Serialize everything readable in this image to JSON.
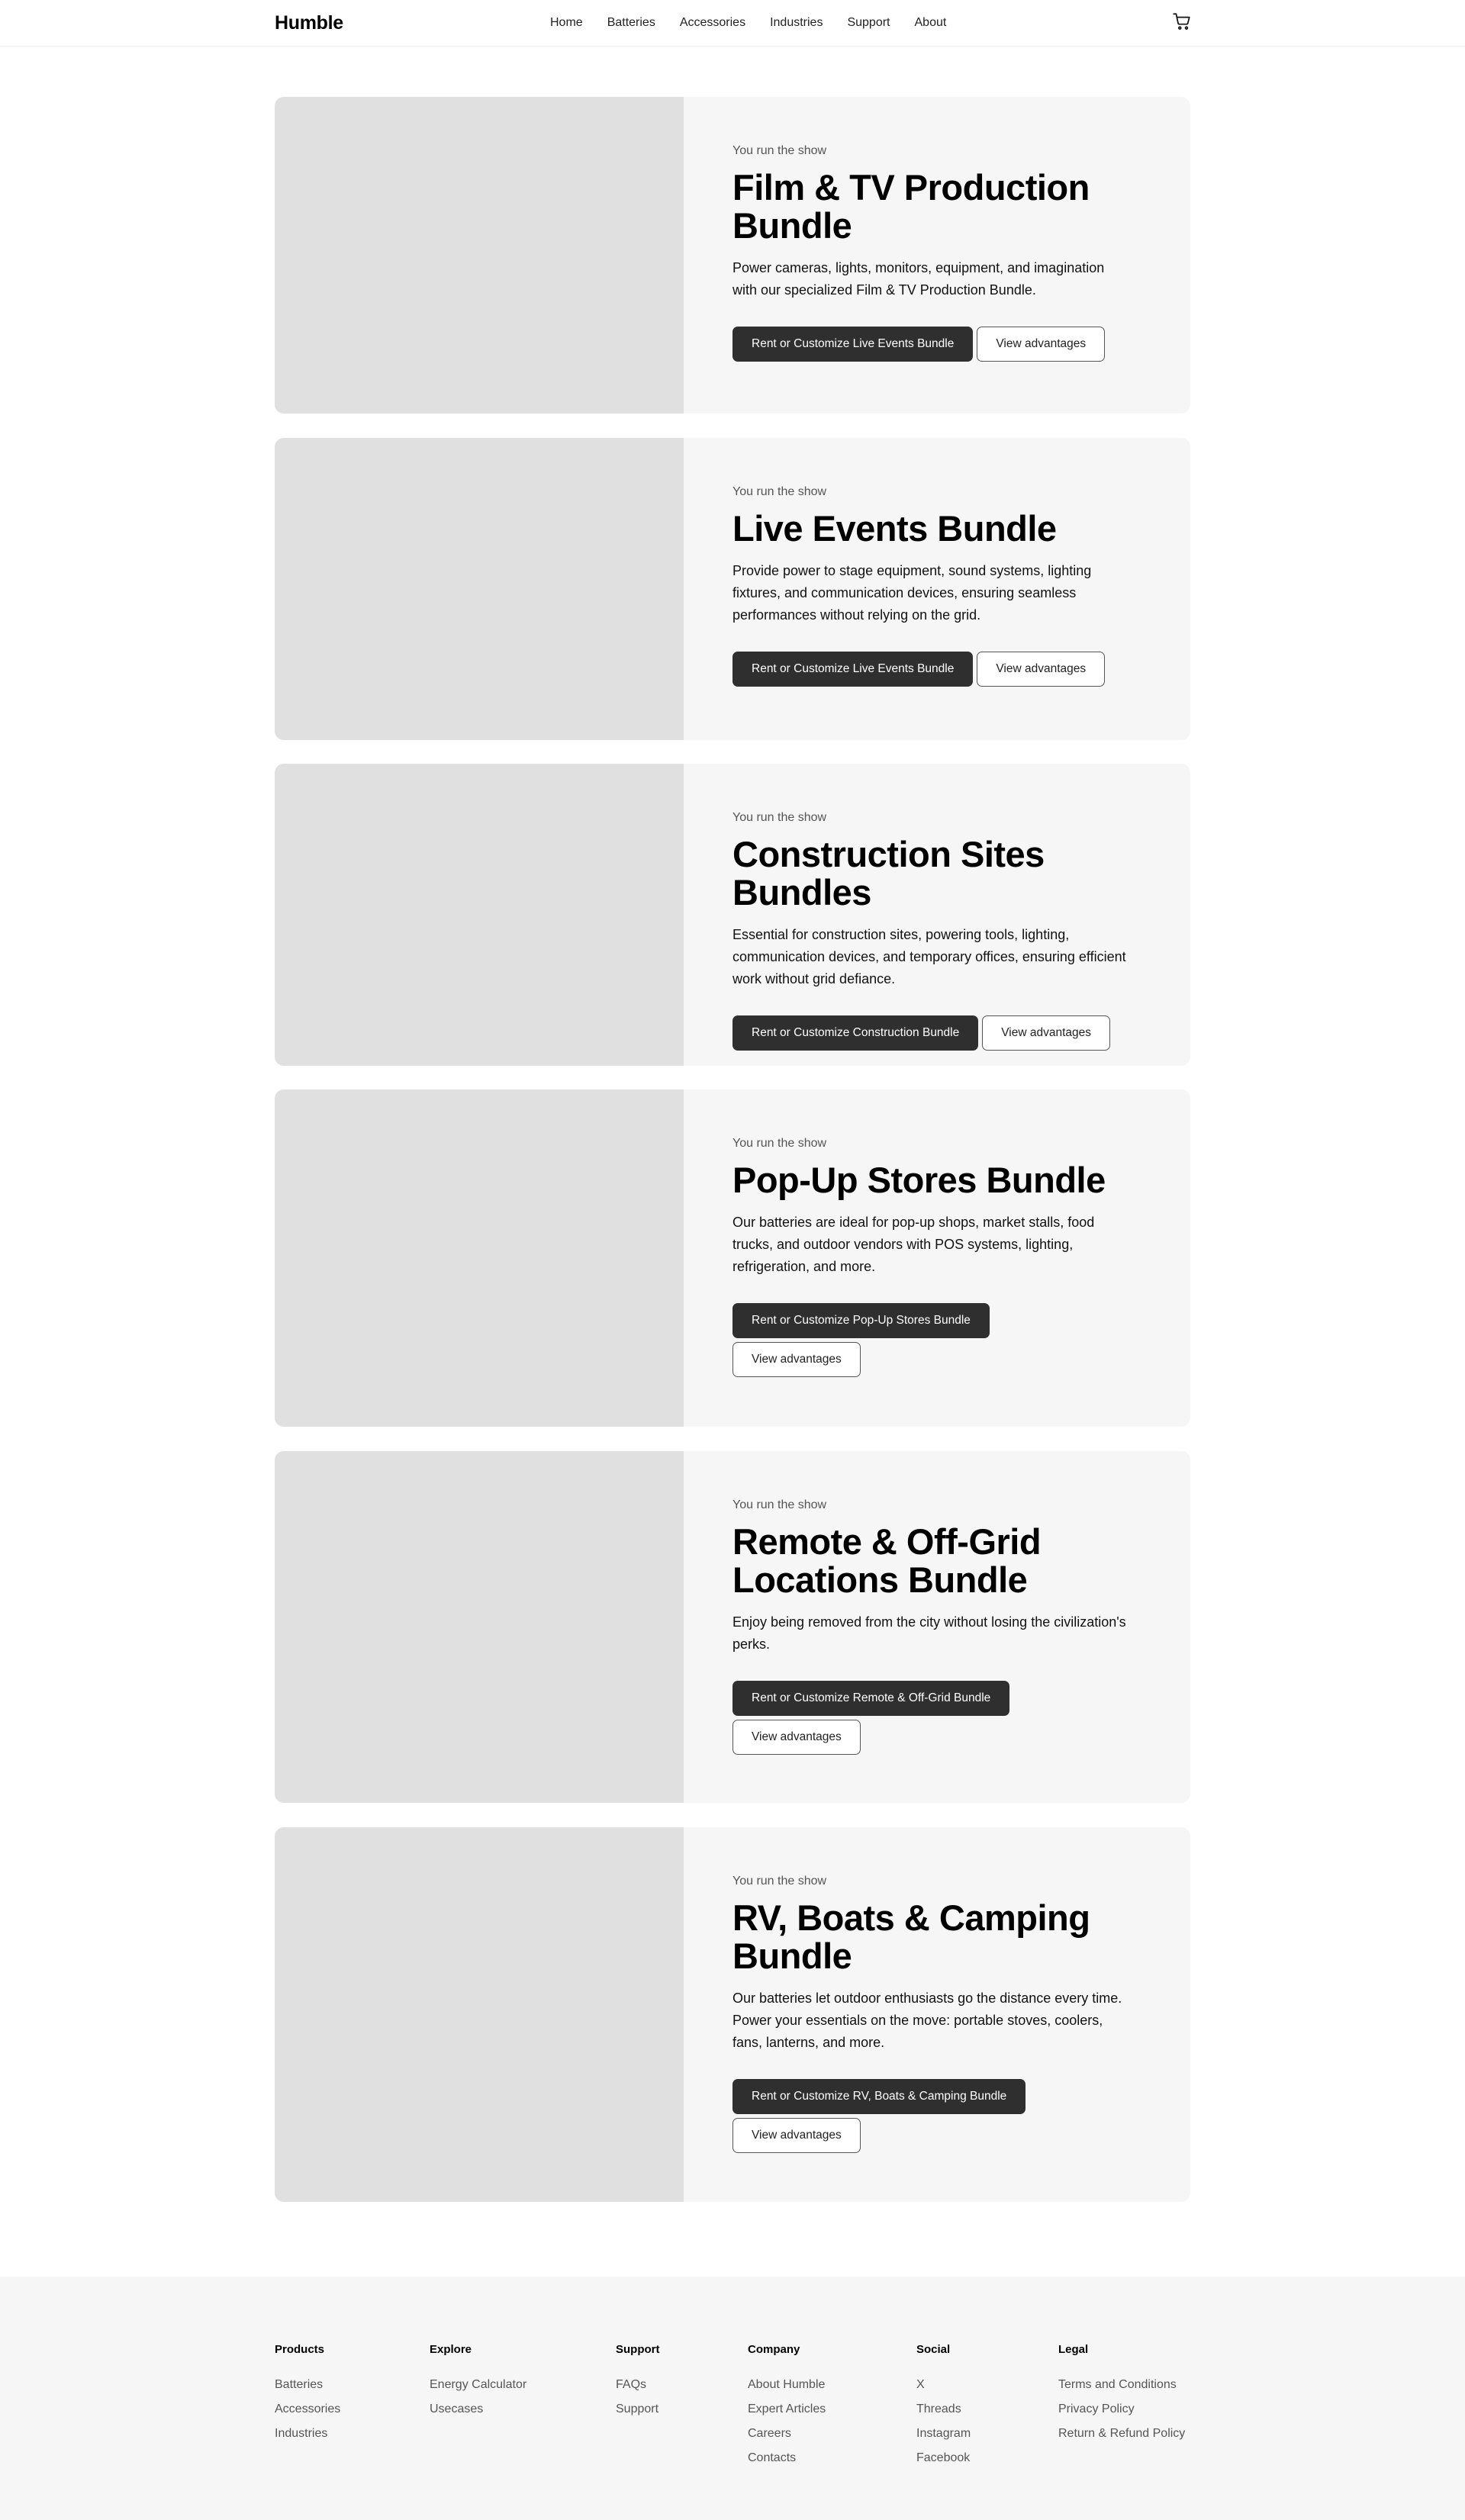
{
  "header": {
    "logo": "Humble",
    "nav": [
      "Home",
      "Batteries",
      "Accessories",
      "Industries",
      "Support",
      "About"
    ],
    "cart_icon": "cart-icon"
  },
  "cards": [
    {
      "eyebrow": "You run the show",
      "title": "Film & TV Production Bundle",
      "description": "Power cameras, lights, monitors, equipment, and imagination with our specialized Film & TV Production Bundle.",
      "primary_label": "Rent or Customize Live Events Bundle",
      "secondary_label": "View advantages"
    },
    {
      "eyebrow": "You run the show",
      "title": "Live Events Bundle",
      "description": "Provide power to stage equipment, sound systems, lighting fixtures, and communication devices, ensuring seamless performances without relying on the grid.",
      "primary_label": "Rent or Customize Live Events Bundle",
      "secondary_label": "View advantages"
    },
    {
      "eyebrow": "You run the show",
      "title": "Construction Sites Bundles",
      "description": "Essential for construction sites, powering tools, lighting, communication devices, and temporary offices, ensuring efficient work without grid defiance.",
      "primary_label": "Rent or Customize Construction Bundle",
      "secondary_label": "View advantages"
    },
    {
      "eyebrow": "You run the show",
      "title": "Pop-Up Stores Bundle",
      "description": "Our batteries are ideal for pop-up shops, market stalls, food trucks, and outdoor vendors with POS systems, lighting, refrigeration, and more.",
      "primary_label": "Rent or Customize Pop-Up Stores Bundle",
      "secondary_label": "View advantages"
    },
    {
      "eyebrow": "You run the show",
      "title": "Remote & Off-Grid Locations Bundle",
      "description": "Enjoy being removed from the city without losing the civilization's perks.",
      "primary_label": "Rent or Customize Remote & Off-Grid Bundle",
      "secondary_label": "View advantages"
    },
    {
      "eyebrow": "You run the show",
      "title": "RV, Boats & Camping Bundle",
      "description": "Our batteries let outdoor enthusiasts go the distance every time. Power your essentials on the move: portable stoves, coolers, fans, lanterns, and more.",
      "primary_label": "Rent or Customize RV, Boats & Camping Bundle",
      "secondary_label": "View advantages"
    }
  ],
  "footer": {
    "columns": [
      {
        "heading": "Products",
        "links": [
          "Batteries",
          "Accessories",
          "Industries"
        ]
      },
      {
        "heading": "Explore",
        "links": [
          "Energy Calculator",
          "Usecases"
        ]
      },
      {
        "heading": "Support",
        "links": [
          "FAQs",
          "Support"
        ]
      },
      {
        "heading": "Company",
        "links": [
          "About Humble",
          "Expert Articles",
          "Careers",
          "Contacts"
        ]
      },
      {
        "heading": "Social",
        "links": [
          "X",
          "Threads",
          "Instagram",
          "Facebook"
        ]
      },
      {
        "heading": "Legal",
        "links": [
          "Terms and Conditions",
          "Privacy Policy",
          "Return & Refund Policy"
        ]
      }
    ]
  }
}
